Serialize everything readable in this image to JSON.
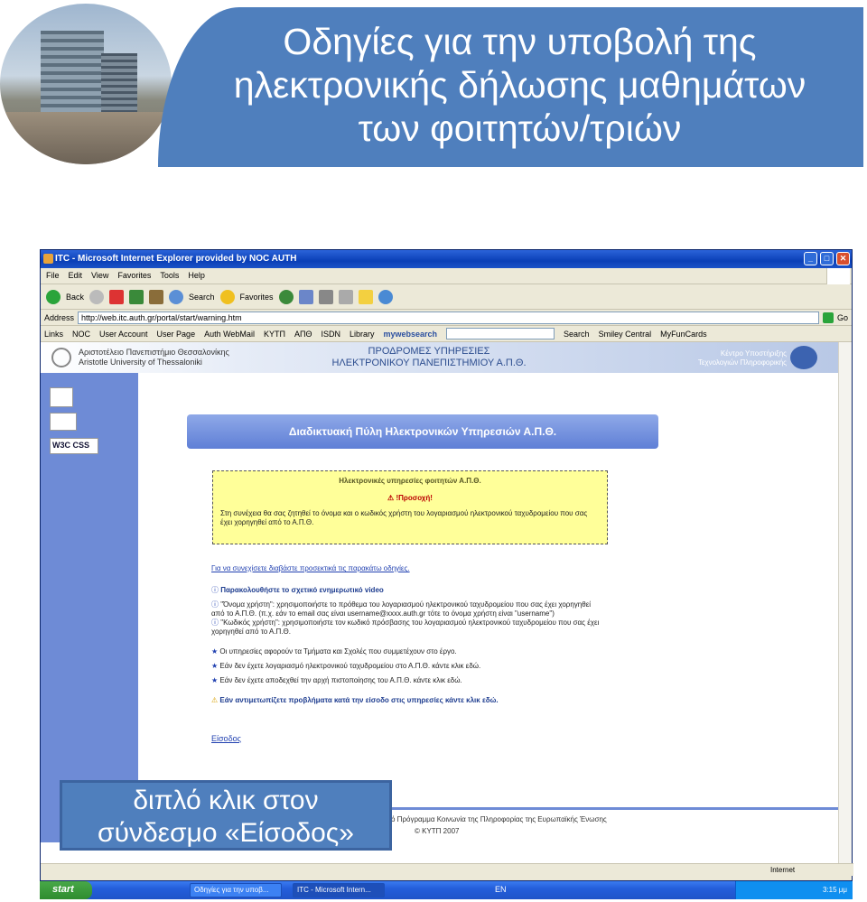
{
  "slide": {
    "title_lines": [
      "Οδηγίες για την υποβολή της",
      "ηλεκτρονικής δήλωσης μαθημάτων",
      "των φοιτητών/τριών"
    ],
    "callout_lines": [
      "διπλό κλικ στον",
      "σύνδεσμο «Είσοδος»"
    ]
  },
  "window": {
    "title": "ITC - Microsoft Internet Explorer provided by NOC AUTH",
    "menu": [
      "File",
      "Edit",
      "View",
      "Favorites",
      "Tools",
      "Help"
    ],
    "toolbar": {
      "back": "Back",
      "search": "Search",
      "favorites": "Favorites"
    },
    "address_label": "Address",
    "address_value": "http://web.itc.auth.gr/portal/start/warning.htm",
    "go_label": "Go",
    "links_label": "Links",
    "links": [
      "NOC",
      "User Account",
      "User Page",
      "Auth WebMail",
      "ΚΥΤΠ",
      "ΑΠΘ",
      "ISDN",
      "Library"
    ],
    "mywebsearch": "mywebsearch",
    "links_right": [
      "Search",
      "Smiley Central",
      "MyFunCards"
    ],
    "status_zone": "Internet"
  },
  "page": {
    "uni_el": "Αριστοτέλειο Πανεπιστήμιο Θεσσαλονίκης",
    "uni_en": "Aristotle University of Thessaloniki",
    "banner_l1": "ΠΡΟΔΡΟΜΕΣ ΥΠΗΡΕΣΙΕΣ",
    "banner_l2": "ΗΛΕΚΤΡΟΝΙΚΟΥ ΠΑΝΕΠΙΣΤΗΜΙΟΥ Α.Π.Θ.",
    "center_l1": "Κέντρο Υποστήριξης",
    "center_l2": "Τεχνολογιών Πληροφορικής",
    "css_badge": "W3C CSS",
    "portal_title": "Διαδικτυακή Πύλη Ηλεκτρονικών Υπηρεσιών Α.Π.Θ.",
    "warn_title": "Ηλεκτρονικές υπηρεσίες φοιτητών Α.Π.Θ.",
    "warn_attention": "!Προσοχή!",
    "warn_text": "Στη συνέχεια θα σας ζητηθεί το όνομα και ο κωδικός χρήστη του λογαριασμού ηλεκτρονικού ταχυδρομείου που σας έχει χορηγηθεί από το Α.Π.Θ.",
    "inst_intro": "Για να συνεχίσετε διαβάστε προσεκτικά τις παρακάτω οδηγίες.",
    "inst_video": "Παρακολουθήστε το σχετικό ενημερωτικό video",
    "inst_user": "\"Όνομα χρήστη\": χρησιμοποιήστε το πρόθεμα του λογαριασμού ηλεκτρονικού ταχυδρομείου που σας έχει χορηγηθεί από το Α.Π.Θ. (π.χ. εάν το email σας είναι username@xxxx.auth.gr τότε το όνομα χρήστη είναι \"username\")",
    "inst_pass": "\"Κωδικός χρήστη\": χρησιμοποιήστε τον κωδικό πρόσβασης του λογαριασμού ηλεκτρονικού ταχυδρομείου που σας έχει χορηγηθεί από το Α.Π.Θ.",
    "bul1": "Οι υπηρεσίες αφορούν τα Τμήματα και Σχολές που συμμετέχουν στο έργο.",
    "bul2": "Εάν δεν έχετε λογαριασμό ηλεκτρονικού ταχυδρομείου στο Α.Π.Θ. κάντε κλικ εδώ.",
    "bul3": "Εάν δεν έχετε αποδεχθεί την αρχή πιστοποίησης του Α.Π.Θ. κάντε κλικ εδώ.",
    "problems": "Εάν αντιμετωπίζετε προβλήματα κατά την είσοδο στις υπηρεσίες κάντε κλικ εδώ.",
    "eisodos": "Είσοδος",
    "footer_1": "ό Πρόγραμμα Κοινωνία της Πληροφορίας της Ευρωπαϊκής Ένωσης",
    "footer_2": "© ΚΥΤΠ 2007"
  },
  "taskbar": {
    "start": "start",
    "tasks": [
      "Οδηγίες για την υποβ...",
      "ITC - Microsoft Intern..."
    ],
    "lang": "EN",
    "time": "3:15 μμ"
  },
  "colors": {
    "accent": "#4f7fbd",
    "sidebar": "#6e8bd6",
    "warning_bg": "#ffff99"
  }
}
